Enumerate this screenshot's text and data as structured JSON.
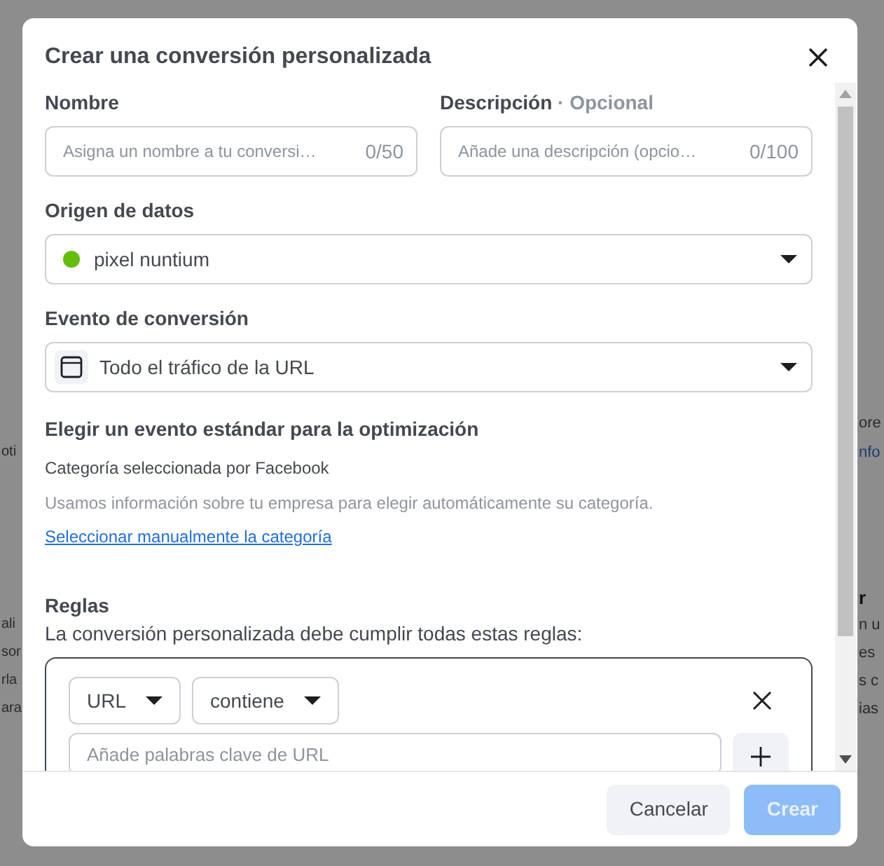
{
  "backdrop": {
    "left": [
      {
        "text": "oti",
        "kind": "plain"
      },
      {
        "text": "ali",
        "kind": "plain"
      },
      {
        "text": "sor",
        "kind": "plain"
      },
      {
        "text": "rla",
        "kind": "plain"
      },
      {
        "text": "ara",
        "kind": "plain"
      }
    ],
    "right": [
      {
        "text": "ore",
        "kind": "plain"
      },
      {
        "text": "nfo",
        "kind": "link"
      },
      {
        "text": "r",
        "kind": "heading"
      },
      {
        "text": "n u",
        "kind": "plain"
      },
      {
        "text": "es",
        "kind": "plain"
      },
      {
        "text": "s c",
        "kind": "plain"
      },
      {
        "text": "ias",
        "kind": "plain"
      }
    ]
  },
  "dialog": {
    "title": "Crear una conversión personalizada",
    "name_field": {
      "label": "Nombre",
      "placeholder": "Asigna un nombre a tu conversi…",
      "counter": "0/50"
    },
    "description_field": {
      "label": "Descripción",
      "optional": "· Opcional",
      "placeholder": "Añade una descripción (opcio…",
      "counter": "0/100"
    },
    "data_source": {
      "label": "Origen de datos",
      "value": "pixel nuntium",
      "color": "#63be09"
    },
    "conversion_event": {
      "label": "Evento de conversión",
      "value": "Todo el tráfico de la URL"
    },
    "standard_event": {
      "heading": "Elegir un evento estándar para la optimización",
      "selected_by": "Categoría seleccionada por Facebook",
      "help": "Usamos información sobre tu empresa para elegir automáticamente su categoría.",
      "link": "Seleccionar manualmente la categoría"
    },
    "rules": {
      "heading": "Reglas",
      "description": "La conversión personalizada debe cumplir todas estas reglas:",
      "field": "URL",
      "operator": "contiene",
      "keyword_placeholder": "Añade palabras clave de URL"
    },
    "buttons": [
      {
        "label": "Cancelar",
        "kind": "secondary",
        "disabled": false
      },
      {
        "label": "Crear",
        "kind": "primary",
        "disabled": true
      }
    ]
  }
}
